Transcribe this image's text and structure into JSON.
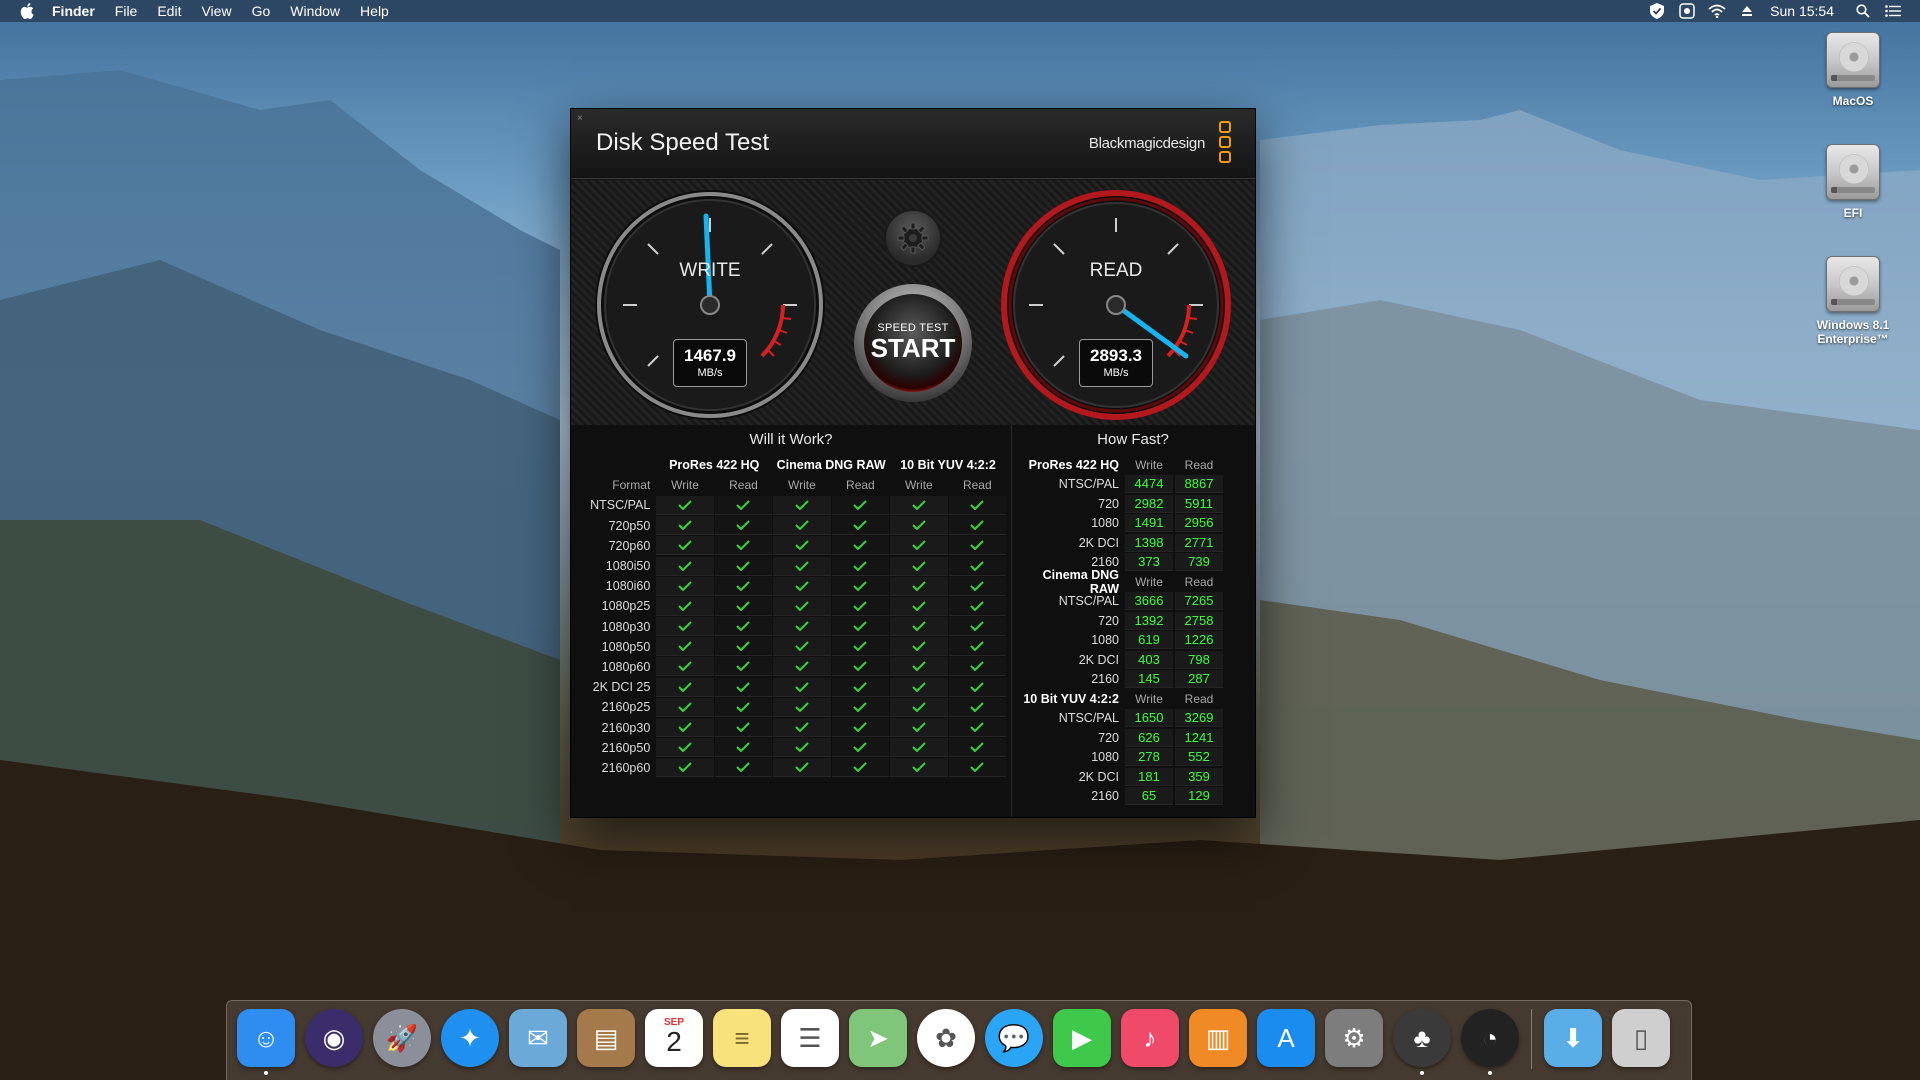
{
  "menubar": {
    "app_name": "Finder",
    "menus": [
      "File",
      "Edit",
      "View",
      "Go",
      "Window",
      "Help"
    ],
    "clock": "Sun 15:54"
  },
  "desktop": {
    "drives": [
      "MacOS",
      "EFI",
      "Windows 8.1 Enterprise™"
    ]
  },
  "window": {
    "close_glyph": "×",
    "title": "Disk Speed Test",
    "brand": "Blackmagicdesign",
    "write_gauge": {
      "label": "WRITE",
      "value": "1467.9",
      "unit": "MB/s"
    },
    "read_gauge": {
      "label": "READ",
      "value": "2893.3",
      "unit": "MB/s"
    },
    "start_button": {
      "small": "SPEED TEST",
      "big": "START"
    },
    "will_it_work": {
      "title": "Will it Work?",
      "groups": [
        "ProRes 422 HQ",
        "Cinema DNG RAW",
        "10 Bit YUV 4:2:2"
      ],
      "format_header": "Format",
      "write_header": "Write",
      "read_header": "Read",
      "formats": [
        "NTSC/PAL",
        "720p50",
        "720p60",
        "1080i50",
        "1080i60",
        "1080p25",
        "1080p30",
        "1080p50",
        "1080p60",
        "2K DCI 25",
        "2160p25",
        "2160p30",
        "2160p50",
        "2160p60"
      ]
    },
    "how_fast": {
      "title": "How Fast?",
      "write_header": "Write",
      "read_header": "Read",
      "groups": [
        {
          "name": "ProRes 422 HQ",
          "rows": [
            {
              "label": "NTSC/PAL",
              "write": "4474",
              "read": "8867"
            },
            {
              "label": "720",
              "write": "2982",
              "read": "5911"
            },
            {
              "label": "1080",
              "write": "1491",
              "read": "2956"
            },
            {
              "label": "2K DCI",
              "write": "1398",
              "read": "2771"
            },
            {
              "label": "2160",
              "write": "373",
              "read": "739"
            }
          ]
        },
        {
          "name": "Cinema DNG RAW",
          "rows": [
            {
              "label": "NTSC/PAL",
              "write": "3666",
              "read": "7265"
            },
            {
              "label": "720",
              "write": "1392",
              "read": "2758"
            },
            {
              "label": "1080",
              "write": "619",
              "read": "1226"
            },
            {
              "label": "2K DCI",
              "write": "403",
              "read": "798"
            },
            {
              "label": "2160",
              "write": "145",
              "read": "287"
            }
          ]
        },
        {
          "name": "10 Bit YUV 4:2:2",
          "rows": [
            {
              "label": "NTSC/PAL",
              "write": "1650",
              "read": "3269"
            },
            {
              "label": "720",
              "write": "626",
              "read": "1241"
            },
            {
              "label": "1080",
              "write": "278",
              "read": "552"
            },
            {
              "label": "2K DCI",
              "write": "181",
              "read": "359"
            },
            {
              "label": "2160",
              "write": "65",
              "read": "129"
            }
          ]
        }
      ]
    }
  },
  "dock": {
    "calendar_month": "SEP",
    "calendar_day": "2",
    "apps": [
      {
        "name": "finder",
        "bg": "#2f8cf0"
      },
      {
        "name": "siri",
        "bg": "#3b2c6b"
      },
      {
        "name": "launchpad",
        "bg": "#8a8f99"
      },
      {
        "name": "safari",
        "bg": "#1f8ff0"
      },
      {
        "name": "mail",
        "bg": "#6aa9d8"
      },
      {
        "name": "contacts",
        "bg": "#a57a4a"
      },
      {
        "name": "calendar",
        "bg": "#ffffff"
      },
      {
        "name": "notes",
        "bg": "#f7e27b"
      },
      {
        "name": "reminders",
        "bg": "#ffffff"
      },
      {
        "name": "maps",
        "bg": "#7fc67a"
      },
      {
        "name": "photos",
        "bg": "#ffffff"
      },
      {
        "name": "messages",
        "bg": "#2aa4f4"
      },
      {
        "name": "facetime",
        "bg": "#3fc94a"
      },
      {
        "name": "itunes",
        "bg": "#f04a6b"
      },
      {
        "name": "ibooks",
        "bg": "#f08a24"
      },
      {
        "name": "app-store",
        "bg": "#1a8cf0"
      },
      {
        "name": "system-preferences",
        "bg": "#7d7d7d"
      },
      {
        "name": "clover-configurator",
        "bg": "#3a3a3a"
      },
      {
        "name": "disk-speed-test",
        "bg": "#222222"
      },
      {
        "name": "downloads",
        "bg": "#5aaee8"
      },
      {
        "name": "trash",
        "bg": "#cfcfcf"
      }
    ]
  }
}
